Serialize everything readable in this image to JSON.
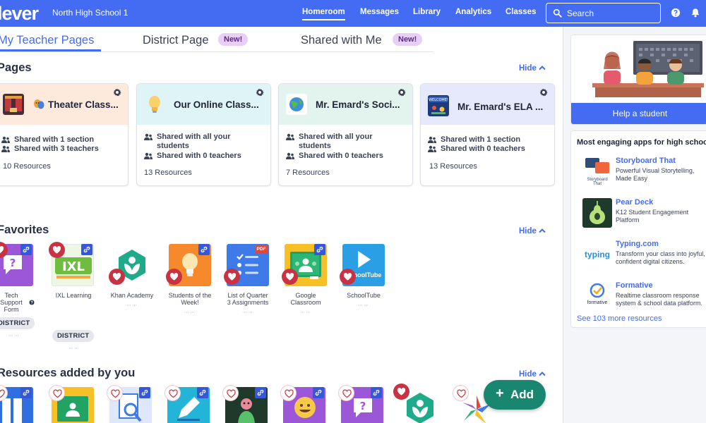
{
  "header": {
    "logo": "lever",
    "school": "North High School 1",
    "nav": [
      "Homeroom",
      "Messages",
      "Library",
      "Analytics",
      "Classes"
    ],
    "search_placeholder": "Search"
  },
  "tabs": {
    "my_pages": "My Teacher Pages",
    "district": "District Page",
    "shared": "Shared with Me",
    "new_badge": "New!"
  },
  "sections": {
    "pages": "Pages",
    "favorites": "Favorites",
    "resources": "Resources added by you",
    "hide": "Hide"
  },
  "pages": [
    {
      "title": "Theater Class...",
      "line1": "Shared with 1 section",
      "line2": "Shared with 3 teachers",
      "resources": "10 Resources"
    },
    {
      "title": "Our Online Class...",
      "line1": "Shared with all your students",
      "line2": "Shared with 0 teachers",
      "resources": "13 Resources"
    },
    {
      "title": "Mr. Emard's Soci...",
      "line1": "Shared with all your students",
      "line2": "Shared with 0 teachers",
      "resources": "7 Resources"
    },
    {
      "title": "Mr. Emard's ELA ...",
      "line1": "Shared with 1 section",
      "line2": "Shared with 0 teachers",
      "resources": "13 Resources"
    }
  ],
  "favorites": [
    {
      "label1": "Tech",
      "label2": "Support",
      "label3": "Form",
      "chip": "DISTRICT"
    },
    {
      "label1": "IXL Learning",
      "chip": "DISTRICT",
      "logo": "IXL"
    },
    {
      "label1": "Khan Academy"
    },
    {
      "label1": "Students of the",
      "label2": "Week!"
    },
    {
      "label1": "List of Quarter",
      "label2": "3 Assignments",
      "pdf": "PDF"
    },
    {
      "label1": "Google",
      "label2": "Classroom"
    },
    {
      "label1": "SchoolTube",
      "logo": "SchoolTube"
    }
  ],
  "add_button": {
    "label": "Add",
    "plus": "+"
  },
  "sidebar": {
    "help_button": "Help a student",
    "apps_title": "Most engaging apps for high school",
    "apps": [
      {
        "name": "Storyboard That",
        "desc": "Powerful Visual Storytelling, Made Easy",
        "logo": "Storyboard That"
      },
      {
        "name": "Pear Deck",
        "desc": "K12 Student Engagement Platform"
      },
      {
        "name": "Typing.com",
        "desc": "Transform your class into joyful, confident digital citizens.",
        "logo": "typing"
      },
      {
        "name": "Formative",
        "desc": "Realtime classroom response system & school data platform.",
        "logo": "formative"
      }
    ],
    "see_more": "See 103 more resources"
  }
}
